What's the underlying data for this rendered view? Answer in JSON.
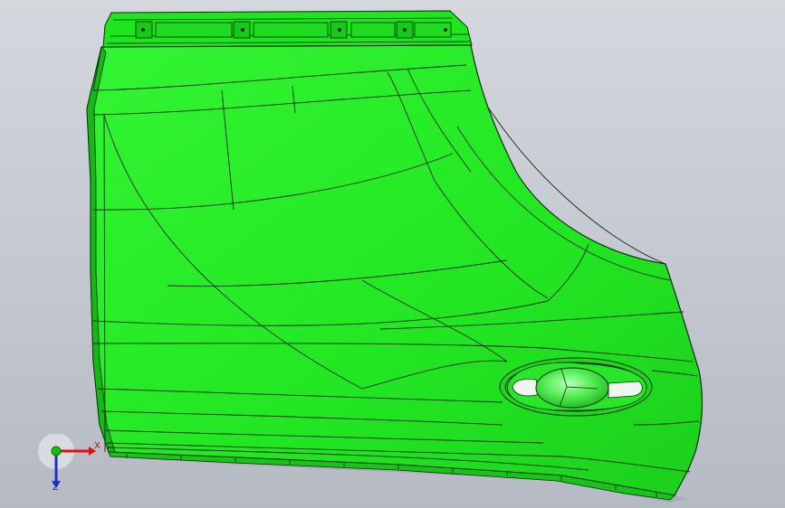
{
  "viewport": {
    "background_top": "#d4d7dd",
    "background_bottom": "#b6bac3"
  },
  "model": {
    "part_name": "door-panel-3d-model",
    "fill_color": "#22e622",
    "highlight_color": "#4dff4d",
    "edge_color": "#0b2b0b"
  },
  "triad": {
    "x_label": "X",
    "z_label": "Z",
    "x_color": "#e01010",
    "y_color": "#10c010",
    "z_color": "#2030d0"
  }
}
